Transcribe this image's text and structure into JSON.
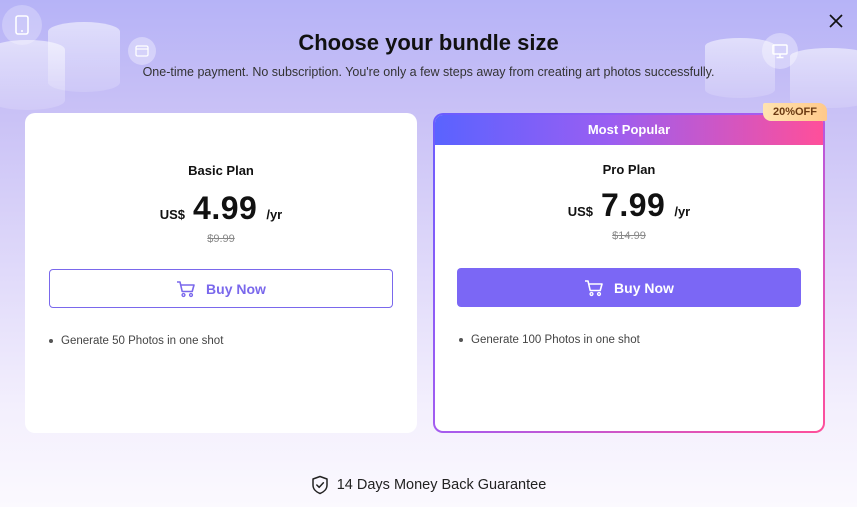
{
  "dialog": {
    "title": "Choose your bundle size",
    "subtitle": "One-time payment. No subscription. You're only a few steps away from creating art photos successfully."
  },
  "plans": [
    {
      "name": "Basic Plan",
      "currency": "US$",
      "price": "4.99",
      "period": "/yr",
      "original_price": "$9.99",
      "button_label": "Buy Now",
      "feature": "Generate 50 Photos in one shot"
    },
    {
      "ribbon": "Most Popular",
      "badge": "20%OFF",
      "name": "Pro Plan",
      "currency": "US$",
      "price": "7.99",
      "period": "/yr",
      "original_price": "$14.99",
      "button_label": "Buy Now",
      "feature": "Generate 100 Photos in one shot"
    }
  ],
  "guarantee": "14 Days Money Back Guarantee",
  "icons": {
    "close": "close-icon",
    "cart": "cart-icon",
    "shield": "shield-check-icon"
  },
  "colors": {
    "accent": "#7b67f5",
    "gradient_start": "#5a63ff",
    "gradient_end": "#ff4f9a"
  }
}
